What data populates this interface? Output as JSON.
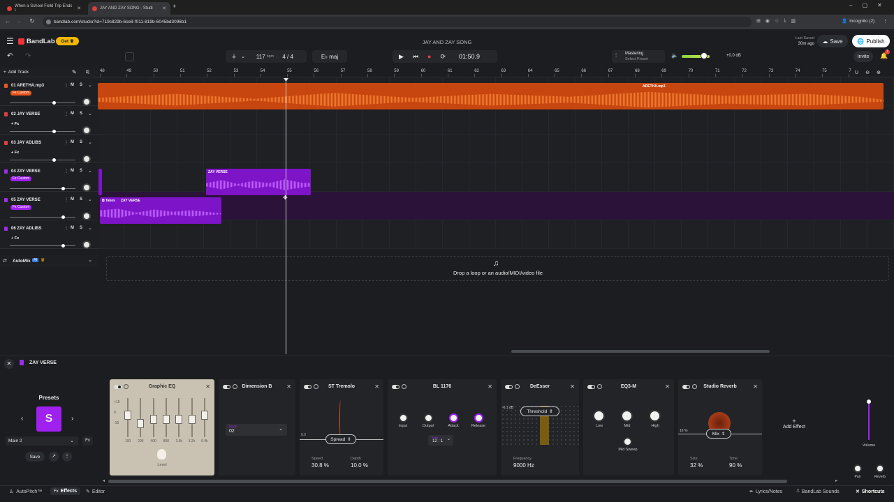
{
  "browser": {
    "tabs": [
      {
        "title": "When a School Field Trip Ends \\"
      },
      {
        "title": "JAY AND ZAY SONG - Studi"
      }
    ],
    "url": "bandlab.com/studio?id=719c829b-6ce8-f011-819b-6045bd3096b1",
    "profile": "Incognito (2)"
  },
  "header": {
    "brand": "BandLab",
    "get_label": "Get",
    "project_title": "JAY AND ZAY SONG",
    "last_saved_label": "Last Saved",
    "last_saved_time": "30m ago",
    "save_label": "Save",
    "publish_label": "Publish",
    "invite_label": "Invite",
    "notif_count": "1"
  },
  "toolbar": {
    "bpm": "117",
    "bpm_unit": "bpm",
    "time_sig": "4 / 4",
    "key": "E♭ maj",
    "time": "01:50.9",
    "mastering_label": "Mastering",
    "mastering_preset": "Select Preset",
    "master_gain": "+0.0 dB"
  },
  "ruler": {
    "bars": [
      "48",
      "49",
      "50",
      "51",
      "52",
      "53",
      "54",
      "55",
      "56",
      "57",
      "58",
      "59",
      "60",
      "61",
      "62",
      "63",
      "64",
      "65",
      "66",
      "67",
      "68",
      "69",
      "70",
      "71",
      "72",
      "73",
      "74",
      "75",
      "7"
    ]
  },
  "add_track_label": "Add Track",
  "tracks": [
    {
      "name": "01  ARETHA.mp3",
      "fx": "Fx Custom",
      "fx_color": "#e8541a",
      "arm": "#e05a2a"
    },
    {
      "name": "02  JAY VERSE",
      "fx": "+ Fx",
      "arm": "#d94040"
    },
    {
      "name": "03  JAY ADLIBS",
      "fx": "+ Fx",
      "arm": "#d94040"
    },
    {
      "name": "04  ZAY VERSE",
      "fx": "Fx Custom",
      "fx_color": "#a020f0",
      "arm": "#9b2ee8"
    },
    {
      "name": "05  ZAY VERSE",
      "fx": "Fx Custom",
      "fx_color": "#a020f0",
      "arm": "#9b2ee8"
    },
    {
      "name": "06  ZAY ADLIBS",
      "fx": "+ Fx",
      "arm": "#9b2ee8"
    }
  ],
  "track_buttons": {
    "mute": "M",
    "solo": "S"
  },
  "clips": {
    "aretha": "ARETHA.mp3",
    "zay4": "ZAY VERSE",
    "takes": "Takes",
    "zay5": "ZAY VERSE"
  },
  "automix": {
    "label": "AutoMix",
    "badge": "AI"
  },
  "dropzone": "Drop a loop or an audio/MIDI/video file",
  "fx_panel": {
    "track_name": "ZAY VERSE",
    "presets_label": "Presets",
    "preset_letter": "S",
    "preset_name": "Main 2",
    "save_label": "Save",
    "add_effect": "Add Effect",
    "effects": {
      "graphic_eq": {
        "title": "Graphic EQ",
        "bands": [
          "100",
          "200",
          "400",
          "800",
          "1.6k",
          "3.2k",
          "6.4k"
        ],
        "scale": [
          "+15",
          "0",
          "-15"
        ],
        "level_label": "Level"
      },
      "dimension_b": {
        "title": "Dimension B",
        "mode_label": "Mode",
        "mode_value": "02"
      },
      "st_tremolo": {
        "title": "ST Tremolo",
        "shape": "Spread",
        "zero": "0.0",
        "speed_label": "Speed",
        "speed": "30.8 %",
        "depth_label": "Depth",
        "depth": "10.0 %"
      },
      "bl1176": {
        "title": "BL 1176",
        "knobs": [
          "Input",
          "Output",
          "Attack",
          "Release"
        ],
        "ratio_label": "Ratio",
        "ratio": "12 : 1"
      },
      "deesser": {
        "title": "DeEsser",
        "db": "-6.1 dB",
        "mode": "Threshold",
        "freq_label": "Frequency",
        "freq": "9000 Hz"
      },
      "eq3m": {
        "title": "EQ3-M",
        "knobs": [
          "Low",
          "Mid",
          "High"
        ],
        "sweep": "Mid Sweep"
      },
      "studio_reverb": {
        "title": "Studio Reverb",
        "mix_label": "Mix",
        "pct": "16 %",
        "size_label": "Size",
        "size": "32 %",
        "tone_label": "Tone",
        "tone": "90 %"
      }
    },
    "volume_label": "Volume",
    "pan_label": "Pan",
    "reverb_label": "Reverb"
  },
  "bottom_tabs": {
    "autopitch": "AutoPitch™",
    "effects": "Effects",
    "editor": "Editor",
    "lyrics": "Lyrics/Notes",
    "sounds": "BandLab Sounds",
    "shortcuts": "Shortcuts"
  }
}
